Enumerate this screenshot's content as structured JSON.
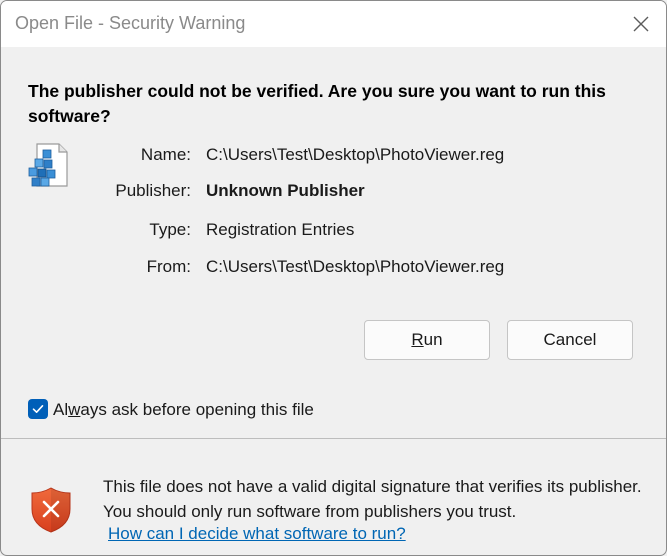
{
  "window": {
    "title": "Open File - Security Warning"
  },
  "headline": "The publisher could not be verified.  Are you sure you want to run this software?",
  "details": {
    "name": {
      "label": "Name:",
      "value": "C:\\Users\\Test\\Desktop\\PhotoViewer.reg"
    },
    "publisher": {
      "label": "Publisher:",
      "value": "Unknown Publisher"
    },
    "type": {
      "label": "Type:",
      "value": "Registration Entries"
    },
    "from": {
      "label": "From:",
      "value": "C:\\Users\\Test\\Desktop\\PhotoViewer.reg"
    }
  },
  "buttons": {
    "run": {
      "mnemonic": "R",
      "rest": "un"
    },
    "cancel": "Cancel"
  },
  "checkbox": {
    "checked": true,
    "label_before": "Al",
    "label_mnemonic": "w",
    "label_after": "ays ask before opening this file"
  },
  "warning": {
    "text": "This file does not have a valid digital signature that verifies its publisher.  You should only run software from publishers you trust.",
    "link": "How can I decide what software to run?"
  },
  "icons": {
    "close": "close-icon",
    "file": "registry-file-icon",
    "shield": "shield-warning-icon",
    "check": "checkmark-icon"
  },
  "colors": {
    "accent": "#005fb8",
    "link": "#0066b4",
    "shield": "#e8532a"
  }
}
